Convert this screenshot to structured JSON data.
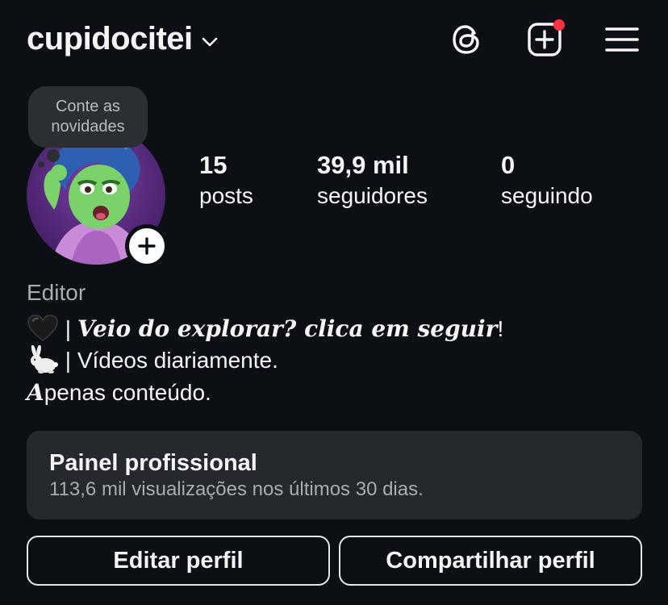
{
  "header": {
    "username": "cupidocitei",
    "icons": [
      "chevron-down-icon",
      "threads-icon",
      "new-post-icon",
      "menu-icon"
    ],
    "notification_color": "#ff3040"
  },
  "profile": {
    "note": "Conte as novidades",
    "stats": {
      "posts": {
        "value": "15",
        "label": "posts"
      },
      "followers": {
        "value": "39,9 mil",
        "label": "seguidores"
      },
      "following": {
        "value": "0",
        "label": "seguindo"
      }
    }
  },
  "bio": {
    "category": "Editor",
    "line1_sep": "| ",
    "line1_text": "Veio do explorar? clica em seguir",
    "line1_end": "!",
    "line2": "| Vídeos diariamente.",
    "line3_first": "A",
    "line3_rest": "penas conteúdo.",
    "emojis": [
      "black-heart-icon",
      "rabbit-icon"
    ]
  },
  "dashboard": {
    "title": "Painel profissional",
    "subtitle": "113,6 mil visualizações nos últimos 30 dias."
  },
  "buttons": {
    "edit": "Editar perfil",
    "share": "Compartilhar perfil"
  },
  "colors": {
    "background": "#0c1014",
    "card": "#25292e",
    "muted_text": "#a8adb3"
  }
}
